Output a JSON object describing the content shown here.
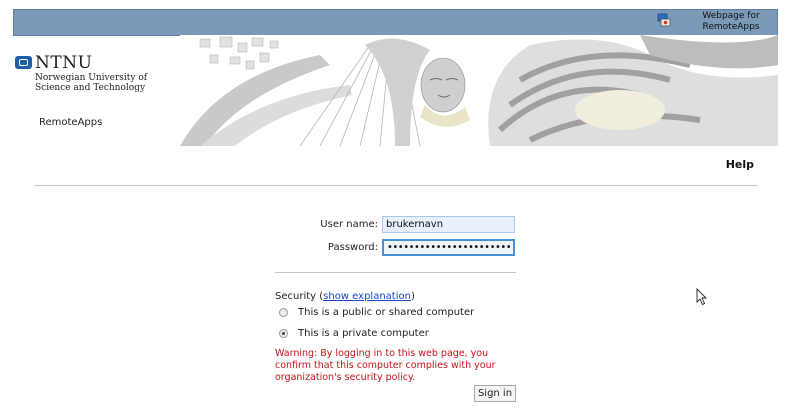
{
  "header": {
    "title_line1": "Webpage for",
    "title_line2": "RemoteApps",
    "icon": "remote-desktop-icon"
  },
  "brand": {
    "name": "NTNU",
    "subtitle": "Norwegian University of Science and Technology",
    "logo_icon": "ntnu-logo-icon",
    "color": "#1f5fa8"
  },
  "app": {
    "label": "RemoteApps"
  },
  "nav": {
    "help_label": "Help"
  },
  "login": {
    "username_label": "User name:",
    "username_value": "brukernavn",
    "password_label": "Password:",
    "password_value": "brukernavnbrukernavnbru"
  },
  "security": {
    "label": "Security (",
    "link_text": "show explanation",
    "label_close": ")",
    "options": [
      {
        "label": "This is a public or shared computer",
        "selected": false
      },
      {
        "label": "This is a private computer",
        "selected": true
      }
    ],
    "warning": "Warning: By logging in to this web page, you confirm that this computer complies with your organization's security policy.",
    "warning_color": "#c0141b"
  },
  "actions": {
    "signin_label": "Sign in"
  }
}
